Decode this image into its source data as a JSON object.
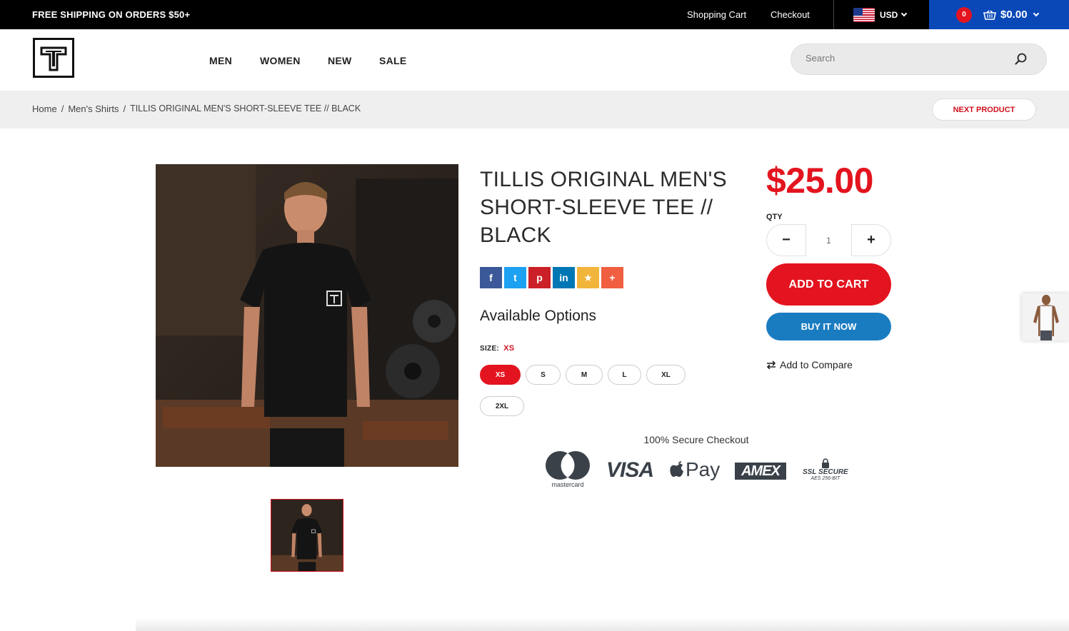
{
  "topbar": {
    "shipping_text": "FREE SHIPPING ON ORDERS $50+",
    "shopping_cart": "Shopping Cart",
    "checkout": "Checkout",
    "currency": "USD",
    "cart_count": "0",
    "cart_total": "$0.00"
  },
  "nav": {
    "items": [
      "MEN",
      "WOMEN",
      "NEW",
      "SALE"
    ]
  },
  "search": {
    "placeholder": "Search"
  },
  "breadcrumb": {
    "home": "Home",
    "sep": "/",
    "category": "Men's Shirts",
    "current": "TILLIS ORIGINAL MEN'S SHORT-SLEEVE TEE // BLACK",
    "next_product": "NEXT PRODUCT"
  },
  "product": {
    "title": "TILLIS ORIGINAL MEN'S SHORT-SLEEVE TEE // BLACK",
    "price": "$25.00",
    "qty_label": "QTY",
    "qty_value": "1",
    "minus": "−",
    "plus": "+",
    "add_to_cart": "ADD TO CART",
    "buy_now": "BUY IT NOW",
    "add_to_compare": "Add to Compare",
    "available_options": "Available Options",
    "size_label": "SIZE:",
    "size_selected": "XS",
    "sizes": [
      "XS",
      "S",
      "M",
      "L",
      "XL",
      "2XL"
    ]
  },
  "share": {
    "icons": [
      "facebook-icon",
      "twitter-icon",
      "pinterest-icon",
      "linkedin-icon",
      "star-icon",
      "plus-icon"
    ],
    "glyphs": [
      "f",
      "t",
      "p",
      "in",
      "★",
      "+"
    ],
    "colors": [
      "#3b5998",
      "#1da1f2",
      "#cb2027",
      "#0077b5",
      "#f2b53b",
      "#f05f40"
    ]
  },
  "checkout_badges": {
    "title": "100% Secure Checkout",
    "mastercard": "mastercard",
    "visa": "VISA",
    "applepay": "Pay",
    "amex": "AMEX",
    "ssl": "SSL SECURE",
    "ssl_sub": "AES 256-BIT"
  },
  "colors": {
    "accent_red": "#e3141f",
    "blue_button": "#1a7cc0",
    "cart_blue": "#0a48b8"
  }
}
